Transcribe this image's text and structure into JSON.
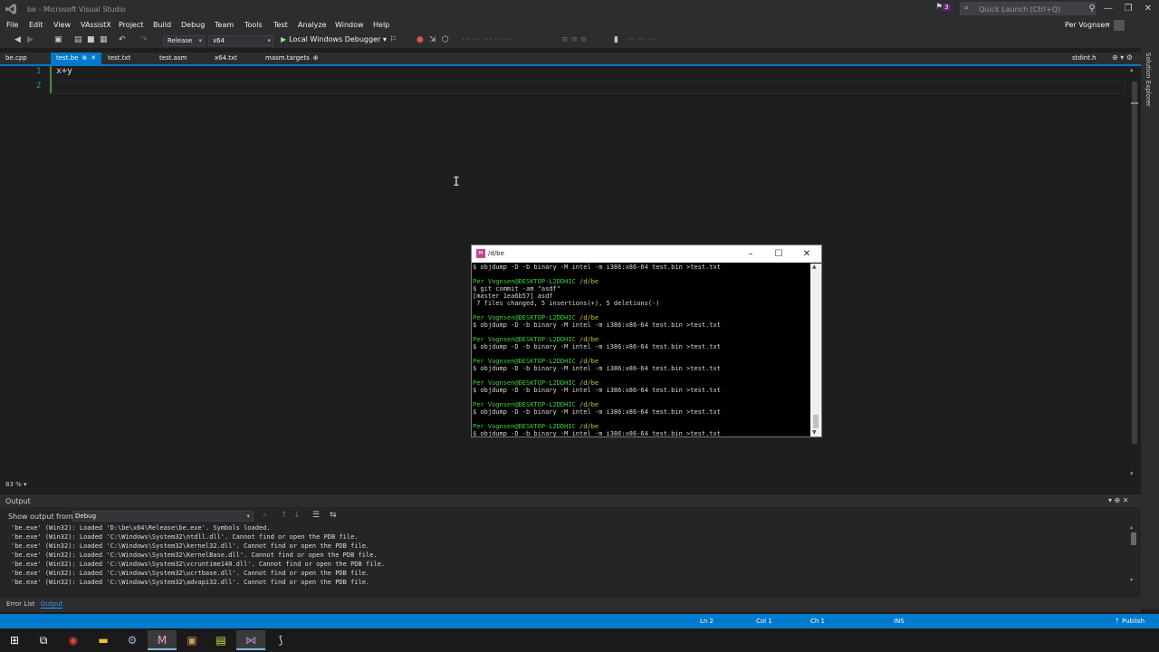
{
  "window": {
    "title": "be - Microsoft Visual Studio",
    "notification_count": "3",
    "quick_launch_placeholder": "Quick Launch (Ctrl+Q)",
    "user": "Per Vognsen"
  },
  "menu": [
    "File",
    "Edit",
    "View",
    "VAssistX",
    "Project",
    "Build",
    "Debug",
    "Team",
    "Tools",
    "Test",
    "Analyze",
    "Window",
    "Help"
  ],
  "toolbar": {
    "configuration": "Release",
    "platform": "x64",
    "debugger": "Local Windows Debugger"
  },
  "tabs": [
    {
      "label": "be.cpp",
      "active": false
    },
    {
      "label": "test.be",
      "active": true
    },
    {
      "label": "test.txt",
      "active": false
    },
    {
      "label": "test.asm",
      "active": false
    },
    {
      "label": "x64.txt",
      "active": false
    },
    {
      "label": "masm.targets",
      "active": false
    }
  ],
  "side_tab": "stdint.h",
  "solution_explorer_label": "Solution Explorer",
  "editor": {
    "lines": [
      {
        "number": "1",
        "text": "x+y"
      },
      {
        "number": "2",
        "text": ""
      }
    ],
    "zoom": "83 %"
  },
  "terminal": {
    "title": "/d/be",
    "lines": [
      {
        "kind": "cmd",
        "text": "$ objdump -D -b binary -M intel -m i386:x86-64 test.bin >test.txt"
      },
      {
        "kind": "blank",
        "text": ""
      },
      {
        "kind": "prompt",
        "user": "Per Vognsen@DESKTOP-L2DDHIC",
        "path": "/d/be"
      },
      {
        "kind": "cmd",
        "text": "$ git commit -am \"asdf\""
      },
      {
        "kind": "cmd",
        "text": "[master 1ea6b57] asdf"
      },
      {
        "kind": "cmd",
        "text": " 7 files changed, 5 insertions(+), 5 deletions(-)"
      },
      {
        "kind": "blank",
        "text": ""
      },
      {
        "kind": "prompt",
        "user": "Per Vognsen@DESKTOP-L2DDHIC",
        "path": "/d/be"
      },
      {
        "kind": "cmd",
        "text": "$ objdump -D -b binary -M intel -m i386:x86-64 test.bin >test.txt"
      },
      {
        "kind": "blank",
        "text": ""
      },
      {
        "kind": "prompt",
        "user": "Per Vognsen@DESKTOP-L2DDHIC",
        "path": "/d/be"
      },
      {
        "kind": "cmd",
        "text": "$ objdump -D -b binary -M intel -m i386:x86-64 test.bin >test.txt"
      },
      {
        "kind": "blank",
        "text": ""
      },
      {
        "kind": "prompt",
        "user": "Per Vognsen@DESKTOP-L2DDHIC",
        "path": "/d/be"
      },
      {
        "kind": "cmd",
        "text": "$ objdump -D -b binary -M intel -m i386:x86-64 test.bin >test.txt"
      },
      {
        "kind": "blank",
        "text": ""
      },
      {
        "kind": "prompt",
        "user": "Per Vognsen@DESKTOP-L2DDHIC",
        "path": "/d/be"
      },
      {
        "kind": "cmd",
        "text": "$ objdump -D -b binary -M intel -m i386:x86-64 test.bin >test.txt"
      },
      {
        "kind": "blank",
        "text": ""
      },
      {
        "kind": "prompt",
        "user": "Per Vognsen@DESKTOP-L2DDHIC",
        "path": "/d/be"
      },
      {
        "kind": "cmd",
        "text": "$ objdump -D -b binary -M intel -m i386:x86-64 test.bin >test.txt"
      },
      {
        "kind": "blank",
        "text": ""
      },
      {
        "kind": "prompt",
        "user": "Per Vognsen@DESKTOP-L2DDHIC",
        "path": "/d/be"
      },
      {
        "kind": "cmd",
        "text": "$ objdump -D -b binary -M intel -m i386:x86-64 test.bin >test.txt"
      }
    ]
  },
  "output": {
    "title": "Output",
    "show_from_label": "Show output from:",
    "source": "Debug",
    "lines": [
      "'be.exe' (Win32): Loaded 'D:\\be\\x64\\Release\\be.exe'. Symbols loaded.",
      "'be.exe' (Win32): Loaded 'C:\\Windows\\System32\\ntdll.dll'. Cannot find or open the PDB file.",
      "'be.exe' (Win32): Loaded 'C:\\Windows\\System32\\kernel32.dll'. Cannot find or open the PDB file.",
      "'be.exe' (Win32): Loaded 'C:\\Windows\\System32\\KernelBase.dll'. Cannot find or open the PDB file.",
      "'be.exe' (Win32): Loaded 'C:\\Windows\\System32\\vcruntime140.dll'. Cannot find or open the PDB file.",
      "'be.exe' (Win32): Loaded 'C:\\Windows\\System32\\ucrtbase.dll'. Cannot find or open the PDB file.",
      "'be.exe' (Win32): Loaded 'C:\\Windows\\System32\\advapi32.dll'. Cannot find or open the PDB file."
    ]
  },
  "bottom_tabs": [
    {
      "label": "Error List",
      "active": false
    },
    {
      "label": "Output",
      "active": true
    }
  ],
  "status": {
    "ln": "Ln 2",
    "col": "Col 1",
    "ch": "Ch 1",
    "mode": "INS",
    "publish": "Publish"
  },
  "colors": {
    "accent": "#007acc",
    "terminal_prompt": "#3cd23c",
    "terminal_path": "#d8c030"
  }
}
